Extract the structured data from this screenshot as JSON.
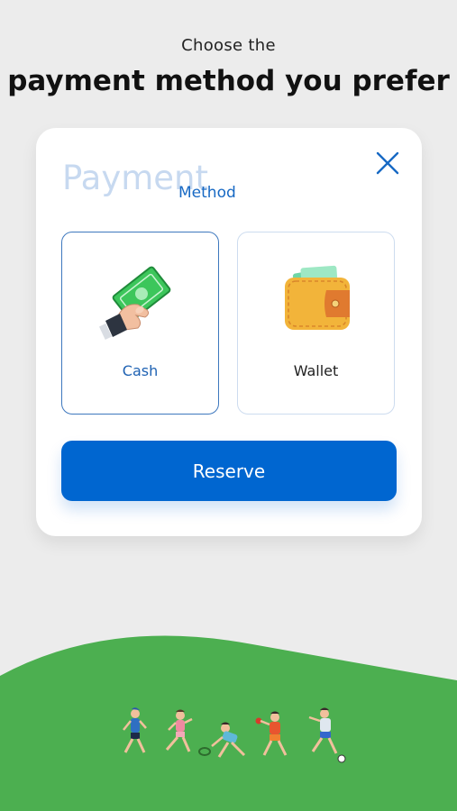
{
  "header": {
    "subtitle": "Choose the",
    "title": "payment method you prefer"
  },
  "dialog": {
    "watermark_title": "Payment",
    "title": "Method",
    "close_icon": "close-icon"
  },
  "payment_options": [
    {
      "label": "Cash",
      "icon": "cash-hand-icon",
      "selected": true
    },
    {
      "label": "Wallet",
      "icon": "wallet-icon",
      "selected": false
    }
  ],
  "actions": {
    "reserve_label": "Reserve"
  },
  "colors": {
    "accent": "#0066d0",
    "background": "#ececec",
    "hill": "#4caf50"
  }
}
